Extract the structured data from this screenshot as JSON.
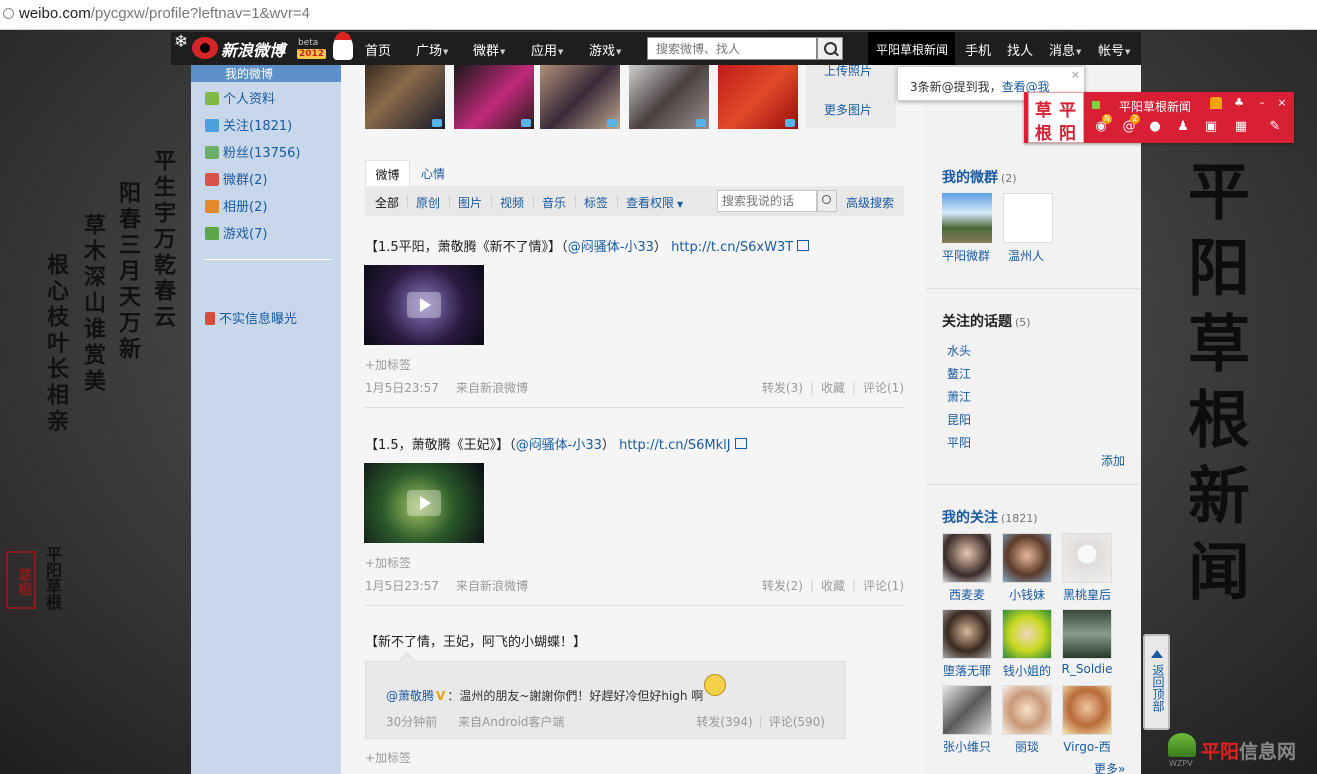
{
  "browser": {
    "url_host": "weibo.com",
    "url_rest": "/pycgxw/profile?leftnav=1&wvr=4"
  },
  "background": {
    "poem_col1": "平生宇万乾春云",
    "poem_col2": "阳春三月天万新",
    "poem_col3": "草木深山谁赏美",
    "poem_col4": "根心枝叶长相亲",
    "big_title": "平阳草根新闻",
    "seal_text": "草根",
    "seal_signature": "平阳草根"
  },
  "topnav": {
    "logo_name": "新浪微博",
    "logo_beta": "beta",
    "logo_year": "2012",
    "items": [
      {
        "label": "首页",
        "dropdown": false
      },
      {
        "label": "广场",
        "dropdown": true
      },
      {
        "label": "微群",
        "dropdown": true
      },
      {
        "label": "应用",
        "dropdown": true
      },
      {
        "label": "游戏",
        "dropdown": true
      }
    ],
    "search_placeholder": "搜索微博、找人",
    "user_name": "平阳草根新闻",
    "right_items": [
      {
        "label": "手机",
        "dropdown": false
      },
      {
        "label": "找人",
        "dropdown": false
      },
      {
        "label": "消息",
        "dropdown": true
      },
      {
        "label": "帐号",
        "dropdown": true
      }
    ]
  },
  "leftnav": {
    "active": "我的微博",
    "items": [
      {
        "label": "个人资料",
        "icon": "profile-icon",
        "color": "#7fb848"
      },
      {
        "label": "关注(1821)",
        "icon": "follow-icon",
        "color": "#4d9fdd"
      },
      {
        "label": "粉丝(13756)",
        "icon": "fans-icon",
        "color": "#6ab06a"
      },
      {
        "label": "微群(2)",
        "icon": "group-icon",
        "color": "#d8534a"
      },
      {
        "label": "相册(2)",
        "icon": "album-icon",
        "color": "#e08a2a"
      },
      {
        "label": "游戏(7)",
        "icon": "game-icon",
        "color": "#5aa54a"
      }
    ],
    "report_label": "不实信息曝光"
  },
  "photos": {
    "upload_label": "上传照片",
    "more_label": "更多图片"
  },
  "tabs": {
    "weibo": "微博",
    "mood": "心情"
  },
  "filters": {
    "items": [
      "全部",
      "原创",
      "图片",
      "视频",
      "音乐",
      "标签"
    ],
    "privacy": "查看权限",
    "search_placeholder": "搜索我说的话",
    "advanced": "高级搜索"
  },
  "posts": [
    {
      "text_pre": "【1.5平阳，萧敬腾《新不了情》】（",
      "mention": "@闷骚体-小33",
      "text_mid": "）",
      "link": "http://t.cn/S6xW3T",
      "tag": "+加标签",
      "time": "1月5日23:57",
      "source": "来自新浪微博",
      "repost": "转发(3)",
      "fav": "收藏",
      "comment": "评论(1)"
    },
    {
      "text_pre": "【1.5，萧敬腾《王妃》】（",
      "mention": "@闷骚体-小33",
      "text_mid": "）",
      "link": "http://t.cn/S6MklJ",
      "tag": "+加标签",
      "time": "1月5日23:57",
      "source": "来自新浪微博",
      "repost": "转发(2)",
      "fav": "收藏",
      "comment": "评论(1)"
    }
  ],
  "post3": {
    "text": "【新不了情，王妃，阿飞的小蝴蝶！】",
    "repost_user": "@萧敬腾",
    "repost_vbadge": "V",
    "repost_text": "：温州的朋友~謝謝你們！好趕好冷但好high 啊",
    "repost_time": "30分钟前",
    "repost_source": "来自Android客户端",
    "repost_repost": "转发(394)",
    "repost_comment": "评论(590)",
    "tag": "+加标签"
  },
  "right": {
    "groups_title": "我的微群",
    "groups_count": "(2)",
    "groups": [
      {
        "name": "平阳微群",
        "icon": "landscape-image"
      },
      {
        "name": "温州人",
        "icon": "calligraphy-image"
      }
    ],
    "topics_title": "关注的话题",
    "topics_count": "(5)",
    "topics": [
      "水头",
      "鳌江",
      "萧江",
      "昆阳",
      "平阳"
    ],
    "topics_add": "添加",
    "follow_title": "我的关注",
    "follow_count": "(1821)",
    "follows": [
      "西麦麦",
      "小钱妹",
      "黑桃皇后",
      "堕落无罪",
      "钱小姐的",
      "R_Soldie",
      "张小维只",
      "丽琰",
      "Virgo-西"
    ],
    "follow_more": "更多»"
  },
  "notice": {
    "text": "3条新@提到我，",
    "link": "查看@我",
    "close": "×"
  },
  "im": {
    "name": "平阳草根新闻",
    "avatar_chars": [
      "草",
      "平",
      "根",
      "阳"
    ],
    "weibo_badge": "N",
    "at_badge": "2",
    "min": "–",
    "close": "×"
  },
  "backtop": {
    "label": "返回顶部"
  },
  "watermark": {
    "prefix": "WZPV",
    "name_red": "平阳",
    "name_gray": "信息网"
  },
  "colors": {
    "link": "#1a5aa0",
    "nav_bg": "#1e1e1e",
    "sidebar_bg": "#c8d8ea",
    "im_red": "#d81f34"
  }
}
